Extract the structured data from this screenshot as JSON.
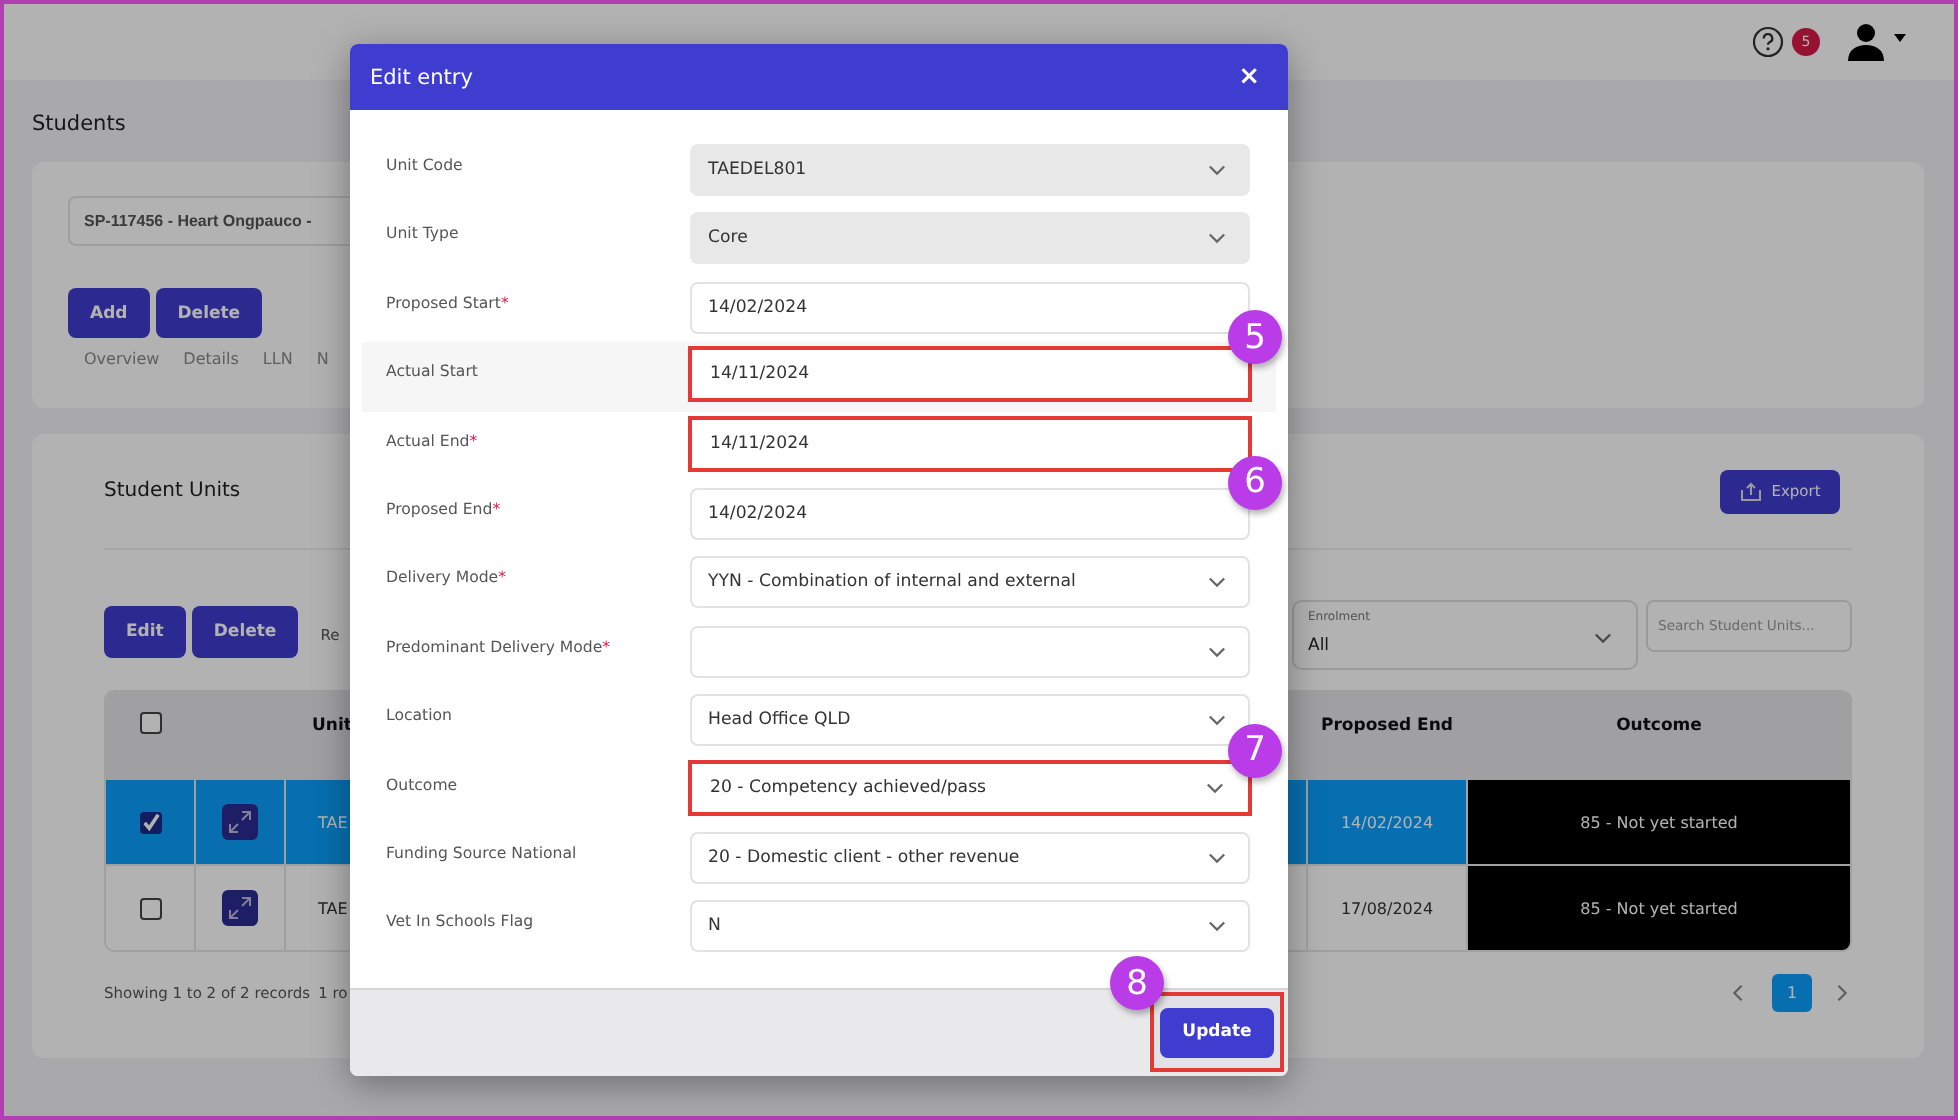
{
  "header": {
    "notification_count": "5"
  },
  "page_title": "Students",
  "student_select": {
    "value": "SP-117456 - Heart Ongpauco -"
  },
  "student_actions": [
    "Add",
    "Delete"
  ],
  "student_tabs": [
    {
      "label": "Overview",
      "selected": false
    },
    {
      "label": "Details",
      "selected": false
    },
    {
      "label": "LLN",
      "selected": false
    },
    {
      "label": "N",
      "selected": false
    }
  ],
  "units_panel": {
    "title": "Student Units",
    "export_label": "Export",
    "actions": [
      "Edit",
      "Delete"
    ],
    "cut_text": "Re",
    "enrolment": {
      "label": "Enrolment",
      "value": "All"
    },
    "search": {
      "placeholder": "Search Student Units..."
    },
    "table": {
      "columns": [
        "Unit",
        "Proposed End",
        "Outcome"
      ],
      "select_all_checked": false,
      "rows": [
        {
          "selected": true,
          "checked": true,
          "unit": "TAE",
          "proposed_end": "14/02/2024",
          "outcome": "85 - Not yet started"
        },
        {
          "selected": false,
          "checked": false,
          "unit": "TAE",
          "proposed_end": "17/08/2024",
          "outcome": "85 - Not yet started"
        }
      ]
    },
    "summary": "Showing 1 to 2 of 2 records",
    "page_size_text": "1 ro",
    "pages": [
      {
        "label": "1",
        "selected": true
      }
    ]
  },
  "dialog": {
    "title": "Edit entry",
    "close": "×",
    "fields": [
      {
        "label": "Unit Code",
        "kind": "select",
        "value": "TAEDEL801",
        "disabled": true
      },
      {
        "label": "Unit Type",
        "kind": "select",
        "value": "Core",
        "disabled": true
      },
      {
        "label": "Proposed Start",
        "required_mark": "*",
        "kind": "date",
        "value": "14/02/2024",
        "disabled": false
      },
      {
        "label": "Actual Start",
        "kind": "date",
        "value": "14/11/2024",
        "disabled": false,
        "focused": true,
        "highlight": true,
        "callout": "5"
      },
      {
        "label": "Actual End",
        "required_mark": "*",
        "kind": "date",
        "value": "14/11/2024",
        "disabled": false,
        "highlight": true,
        "callout": "6"
      },
      {
        "label": "Proposed End",
        "required_mark": "*",
        "kind": "date",
        "value": "14/02/2024",
        "disabled": false
      },
      {
        "label": "Delivery Mode",
        "required_mark": "*",
        "kind": "select",
        "value": "YYN - Combination of internal and external",
        "disabled": false
      },
      {
        "label": "Predominant Delivery Mode",
        "required_mark": "*",
        "kind": "select",
        "disabled": false
      },
      {
        "label": "Location",
        "kind": "select",
        "value": "Head Office QLD",
        "disabled": false
      },
      {
        "label": "Outcome",
        "kind": "select",
        "value": "20 - Competency achieved/pass",
        "disabled": false,
        "highlight": true,
        "callout": "7"
      },
      {
        "label": "Funding Source National",
        "kind": "select",
        "value": "20 - Domestic client - other revenue",
        "disabled": false
      },
      {
        "label": "Vet In Schools Flag",
        "kind": "select",
        "value": "N",
        "disabled": false
      }
    ],
    "submit": {
      "label": "Update",
      "highlight": true,
      "callout": "8"
    }
  }
}
